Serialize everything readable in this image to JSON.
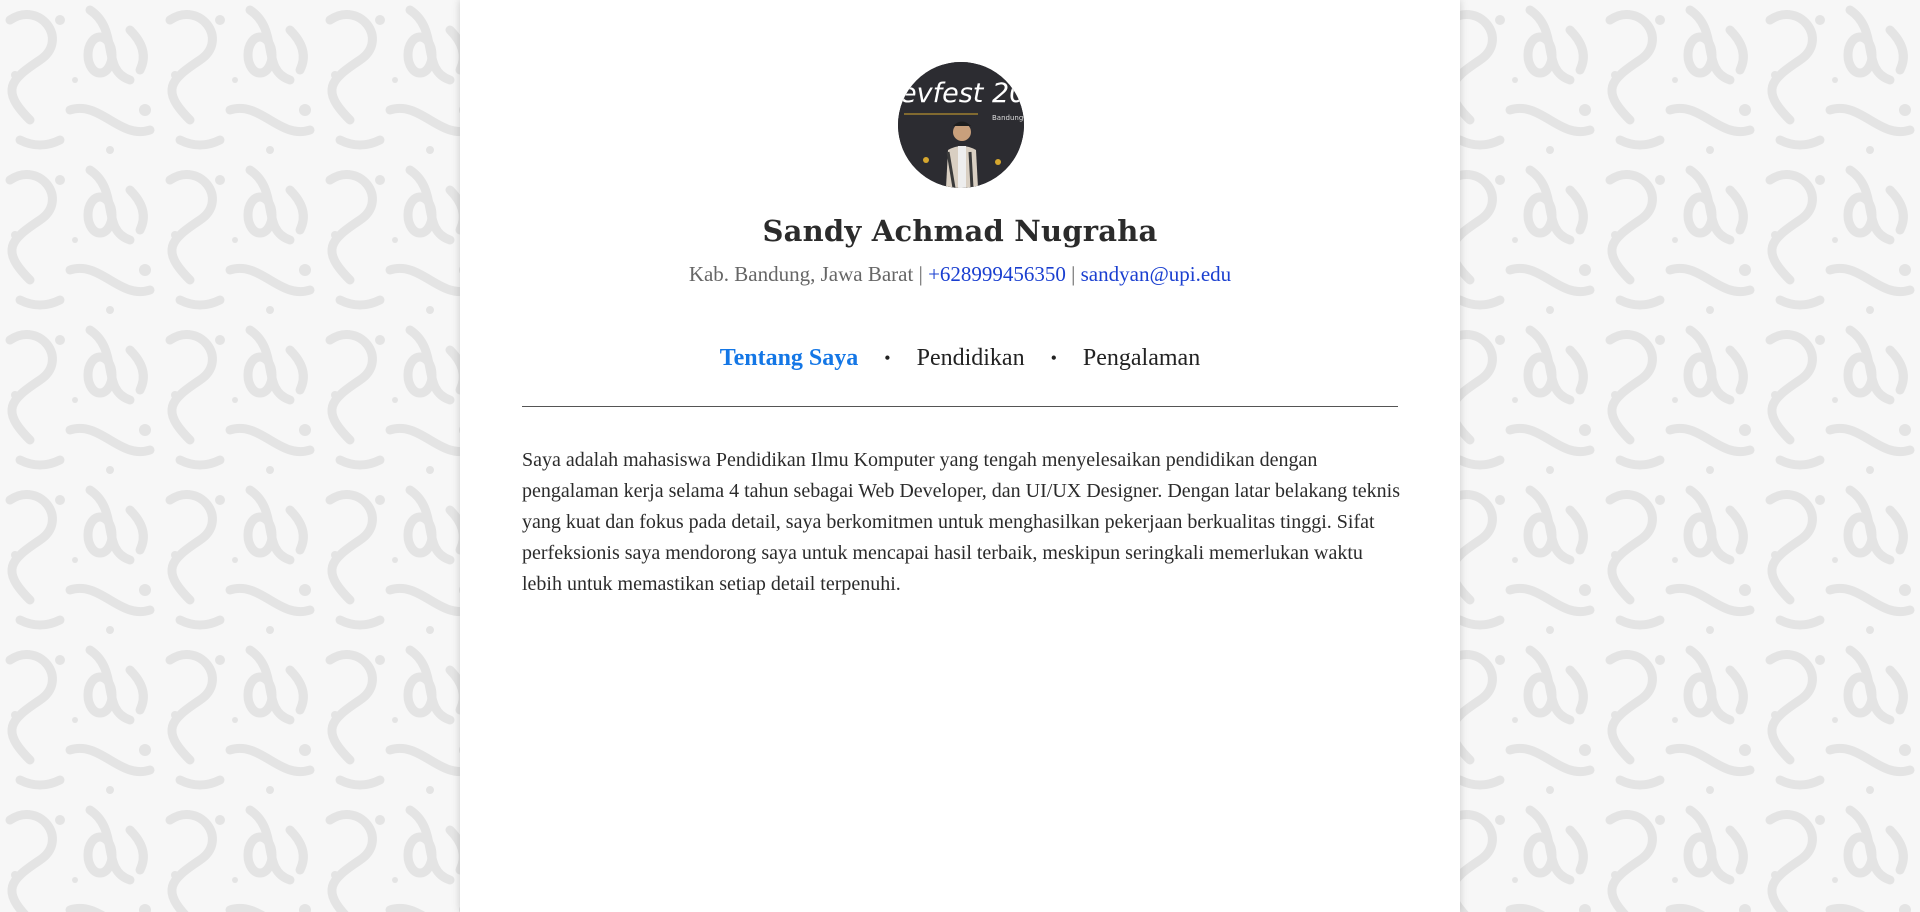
{
  "profile": {
    "name": "Sandy Achmad Nugraha",
    "location": "Kab. Bandung, Jawa Barat",
    "separator": "|",
    "phone": "+628999456350",
    "email": "sandyan@upi.edu",
    "avatar_text": "evfest 20",
    "avatar_subtext": "Bandung"
  },
  "nav": {
    "tabs": [
      {
        "label": "Tentang Saya",
        "active": true
      },
      {
        "label": "Pendidikan",
        "active": false
      },
      {
        "label": "Pengalaman",
        "active": false
      }
    ],
    "bullet": "•"
  },
  "about": {
    "text": "Saya adalah mahasiswa Pendidikan Ilmu Komputer yang tengah menyelesaikan pendidikan dengan pengalaman kerja selama 4 tahun sebagai Web Developer, dan UI/UX Designer. Dengan latar belakang teknis yang kuat dan fokus pada detail, saya berkomitmen untuk menghasilkan pekerjaan berkualitas tinggi. Sifat perfeksionis saya mendorong saya untuk mencapai hasil terbaik, meskipun seringkali memerlukan waktu lebih untuk memastikan setiap detail terpenuhi."
  },
  "colors": {
    "accent": "#1477e6",
    "link": "#1a3fd0",
    "background": "#f7f7f7",
    "pattern": "#e6e6e6"
  }
}
